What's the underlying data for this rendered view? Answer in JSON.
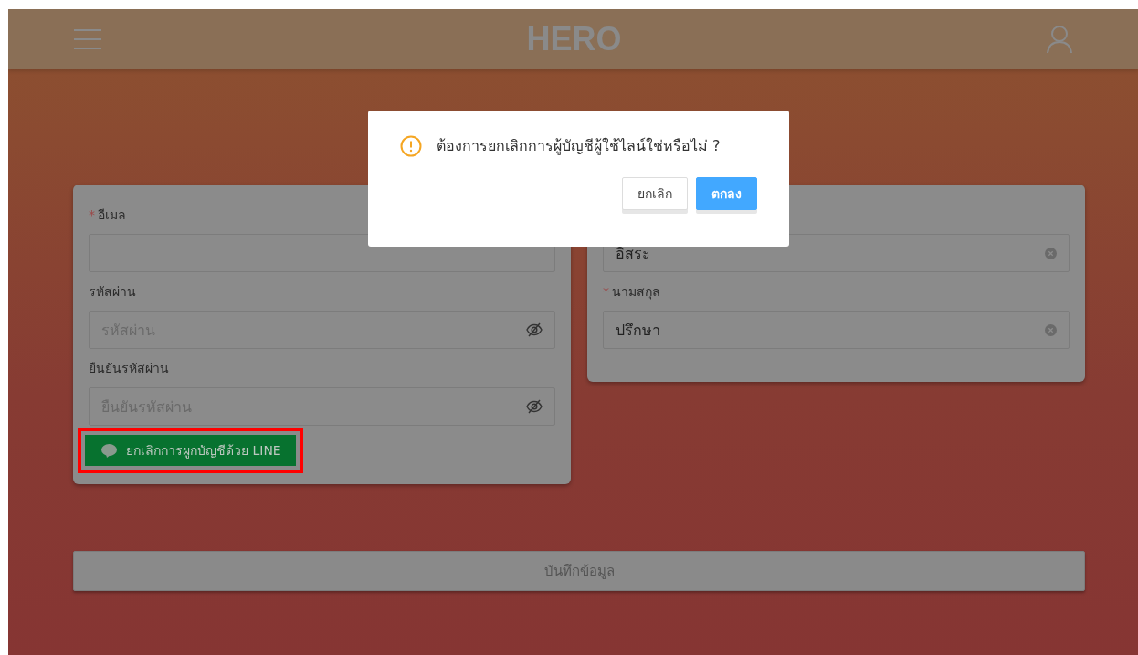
{
  "header": {
    "logo": "HERO"
  },
  "left_form": {
    "fields": [
      {
        "label": "อีเมล",
        "required_mark": "*",
        "kind": "text"
      },
      {
        "label": "รหัสผ่าน",
        "placeholder": "รหัสผ่าน",
        "kind": "password"
      },
      {
        "label": "ยืนยันรหัสผ่าน",
        "placeholder": "ยืนยันรหัสผ่าน",
        "kind": "password"
      }
    ],
    "line_button": {
      "label": "ยกเลิกการผูกบัญชีด้วย LINE",
      "highlighted": true
    }
  },
  "right_form": {
    "fields": [
      {
        "value": "อิสระ",
        "kind": "clearable"
      },
      {
        "label": "นามสกุล",
        "required_mark": "*",
        "value": "ปรึกษา",
        "kind": "clearable"
      }
    ]
  },
  "save_button": {
    "label": "บันทึกข้อมูล",
    "disabled": true
  },
  "dialog": {
    "message": "ต้องการยกเลิกการผู้บัญชีผู้ใช้ไลน์ใช่หรือไม่ ?",
    "buttons": [
      {
        "label": "ยกเลิก",
        "kind": "default"
      },
      {
        "label": "ตกลง",
        "kind": "primary"
      }
    ]
  }
}
